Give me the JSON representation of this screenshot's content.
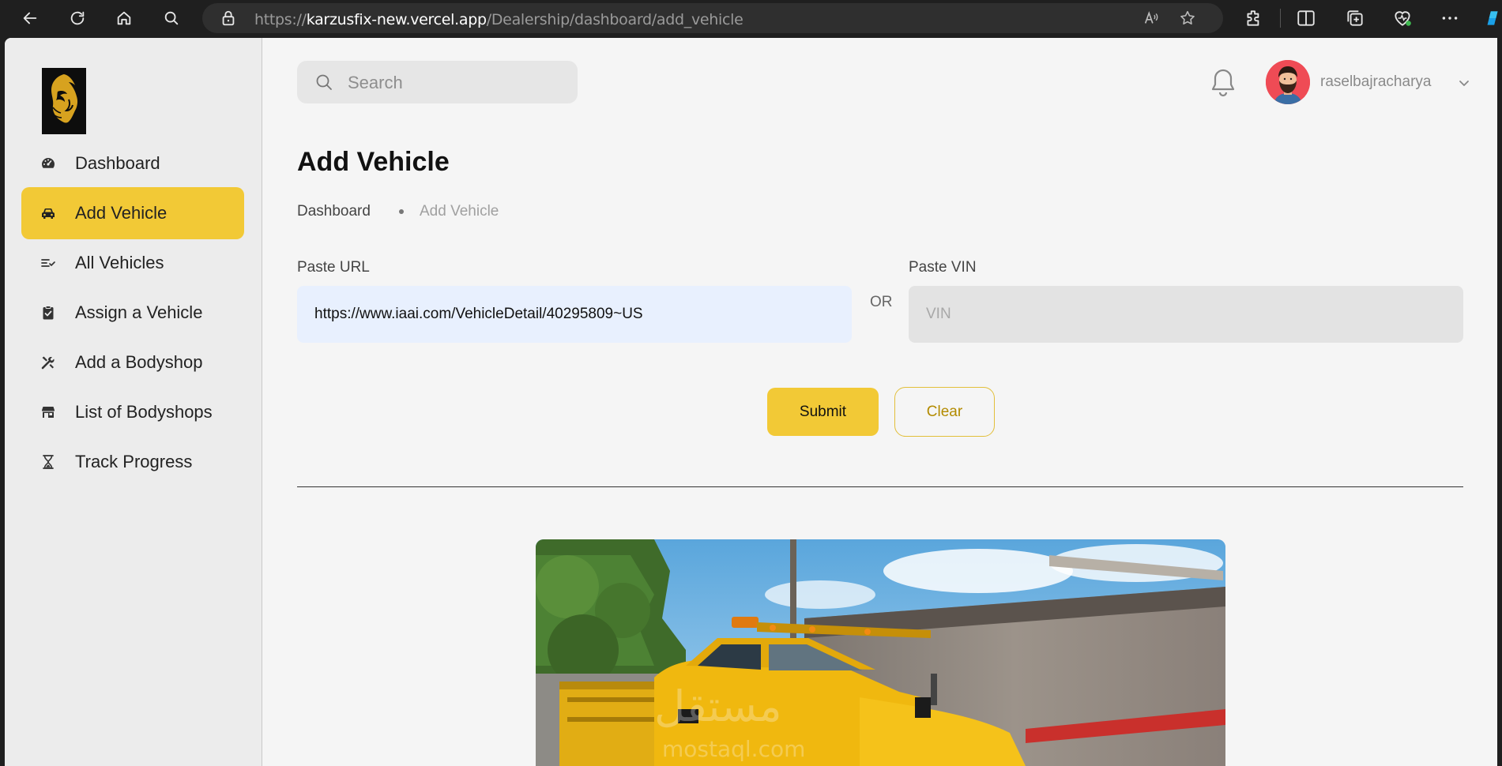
{
  "browser": {
    "url_prefix": "https://",
    "url_host": "karzusfix-new.vercel.app",
    "url_path": "/Dealership/dashboard/add_vehicle"
  },
  "sidebar": {
    "items": [
      {
        "label": "Dashboard",
        "icon": "gauge-icon",
        "active": false
      },
      {
        "label": "Add Vehicle",
        "icon": "car-icon",
        "active": true
      },
      {
        "label": "All Vehicles",
        "icon": "list-check-icon",
        "active": false
      },
      {
        "label": "Assign a Vehicle",
        "icon": "clipboard-check-icon",
        "active": false
      },
      {
        "label": "Add a Bodyshop",
        "icon": "tools-icon",
        "active": false
      },
      {
        "label": "List of Bodyshops",
        "icon": "store-icon",
        "active": false
      },
      {
        "label": "Track Progress",
        "icon": "hourglass-icon",
        "active": false
      }
    ]
  },
  "header": {
    "search_placeholder": "Search",
    "username": "raselbajracharya"
  },
  "page": {
    "title": "Add Vehicle",
    "breadcrumb": {
      "home": "Dashboard",
      "current": "Add Vehicle"
    },
    "form": {
      "url_label": "Paste URL",
      "url_value": "https://www.iaai.com/VehicleDetail/40295809~US",
      "or_text": "OR",
      "vin_label": "Paste VIN",
      "vin_placeholder": "VIN",
      "submit_label": "Submit",
      "clear_label": "Clear"
    }
  },
  "colors": {
    "accent": "#f2c936",
    "sidebar_bg": "#ececec",
    "main_bg": "#f5f5f5",
    "url_input_bg": "#e8f0fe"
  }
}
